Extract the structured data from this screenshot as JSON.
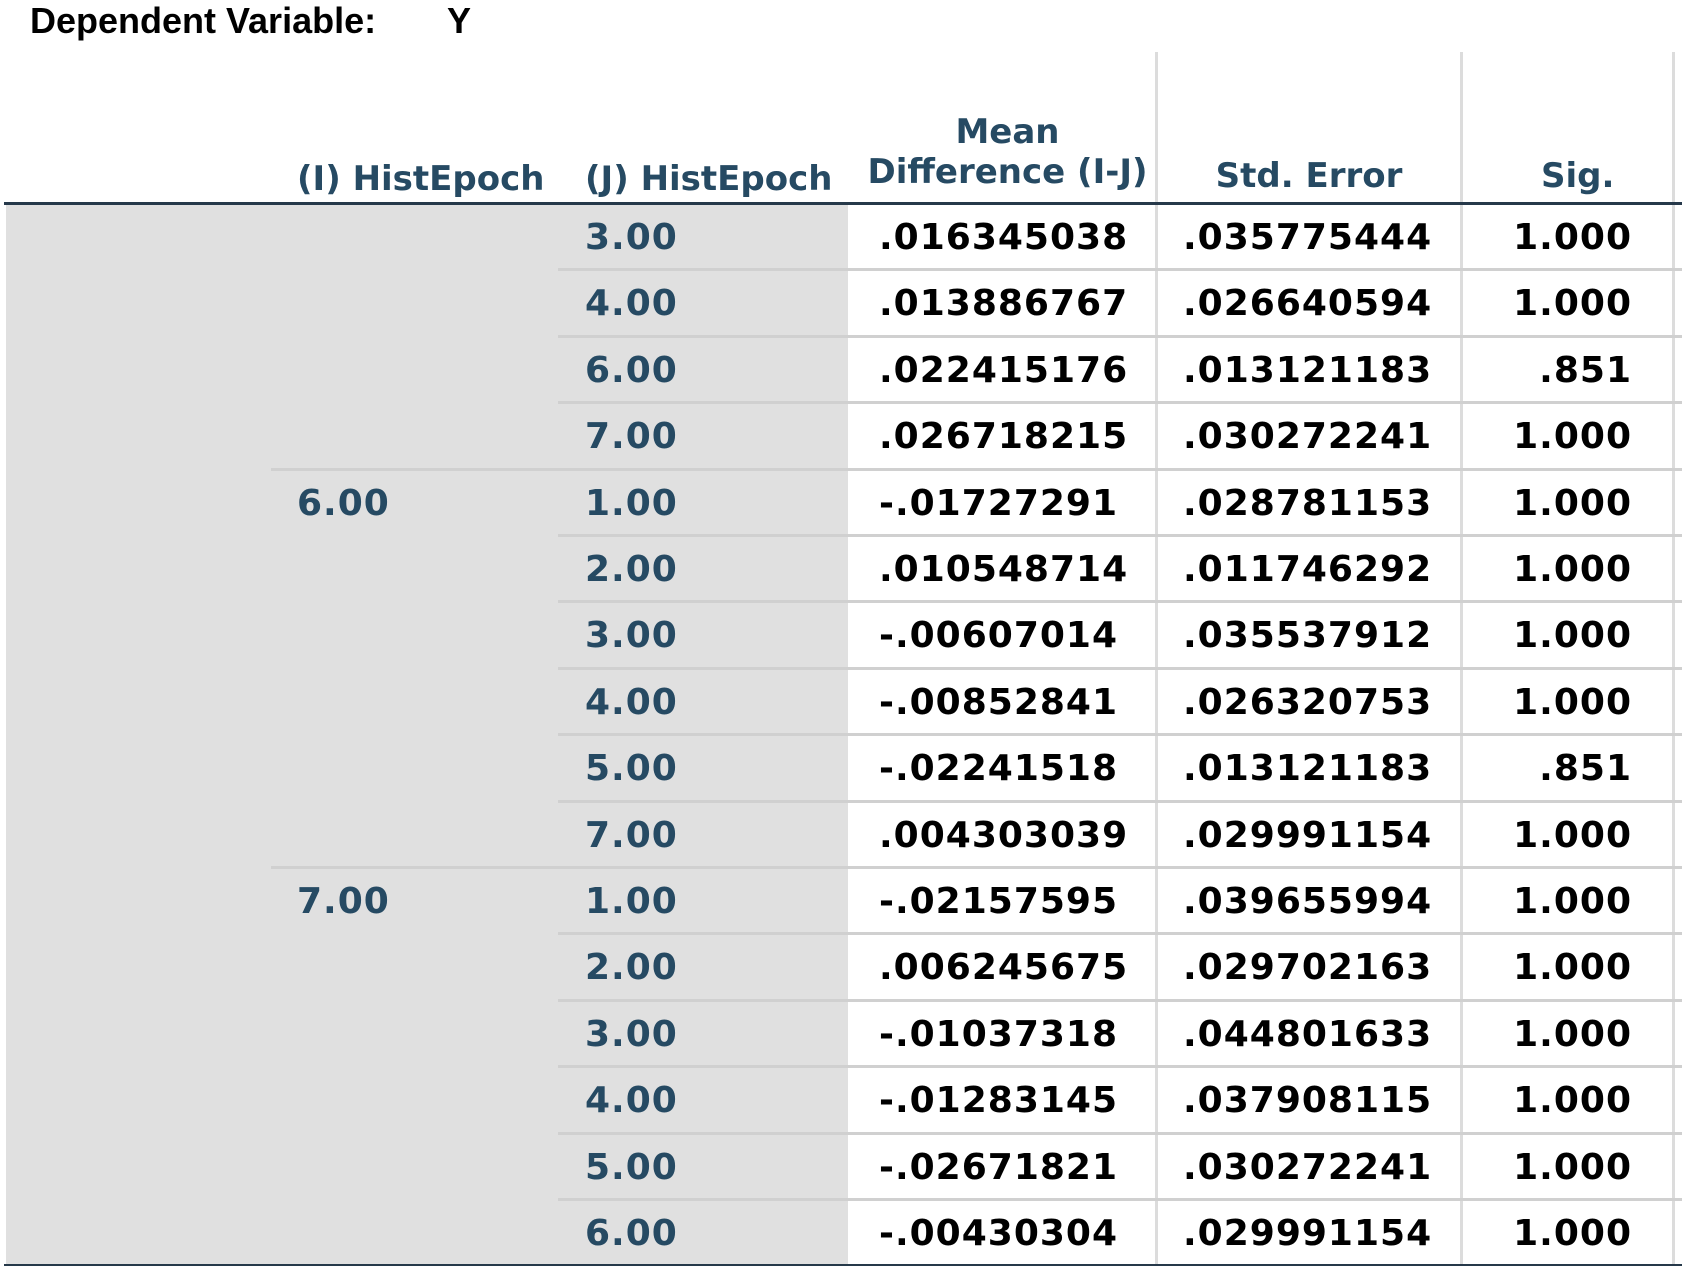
{
  "dependent_variable": {
    "label": "Dependent Variable:",
    "value": "Y"
  },
  "headers": {
    "i_factor": "(I) HistEpoch",
    "j_factor": "(J) HistEpoch",
    "mean_diff_line1": "Mean",
    "mean_diff_line2": "Difference (I-J)",
    "std_error": "Std. Error",
    "sig": "Sig."
  },
  "rows": [
    {
      "i": "",
      "j": "3.00",
      "mean_diff": ".016345038",
      "std_error": ".035775444",
      "sig": "1.000"
    },
    {
      "i": "",
      "j": "4.00",
      "mean_diff": ".013886767",
      "std_error": ".026640594",
      "sig": "1.000"
    },
    {
      "i": "",
      "j": "6.00",
      "mean_diff": ".022415176",
      "std_error": ".013121183",
      "sig": ".851"
    },
    {
      "i": "",
      "j": "7.00",
      "mean_diff": ".026718215",
      "std_error": ".030272241",
      "sig": "1.000"
    },
    {
      "i": "6.00",
      "j": "1.00",
      "mean_diff": "-.01727291",
      "std_error": ".028781153",
      "sig": "1.000"
    },
    {
      "i": "",
      "j": "2.00",
      "mean_diff": ".010548714",
      "std_error": ".011746292",
      "sig": "1.000"
    },
    {
      "i": "",
      "j": "3.00",
      "mean_diff": "-.00607014",
      "std_error": ".035537912",
      "sig": "1.000"
    },
    {
      "i": "",
      "j": "4.00",
      "mean_diff": "-.00852841",
      "std_error": ".026320753",
      "sig": "1.000"
    },
    {
      "i": "",
      "j": "5.00",
      "mean_diff": "-.02241518",
      "std_error": ".013121183",
      "sig": ".851"
    },
    {
      "i": "",
      "j": "7.00",
      "mean_diff": ".004303039",
      "std_error": ".029991154",
      "sig": "1.000"
    },
    {
      "i": "7.00",
      "j": "1.00",
      "mean_diff": "-.02157595",
      "std_error": ".039655994",
      "sig": "1.000"
    },
    {
      "i": "",
      "j": "2.00",
      "mean_diff": ".006245675",
      "std_error": ".029702163",
      "sig": "1.000"
    },
    {
      "i": "",
      "j": "3.00",
      "mean_diff": "-.01037318",
      "std_error": ".044801633",
      "sig": "1.000"
    },
    {
      "i": "",
      "j": "4.00",
      "mean_diff": "-.01283145",
      "std_error": ".037908115",
      "sig": "1.000"
    },
    {
      "i": "",
      "j": "5.00",
      "mean_diff": "-.02671821",
      "std_error": ".030272241",
      "sig": "1.000"
    },
    {
      "i": "",
      "j": "6.00",
      "mean_diff": "-.00430304",
      "std_error": ".029991154",
      "sig": "1.000"
    }
  ]
}
